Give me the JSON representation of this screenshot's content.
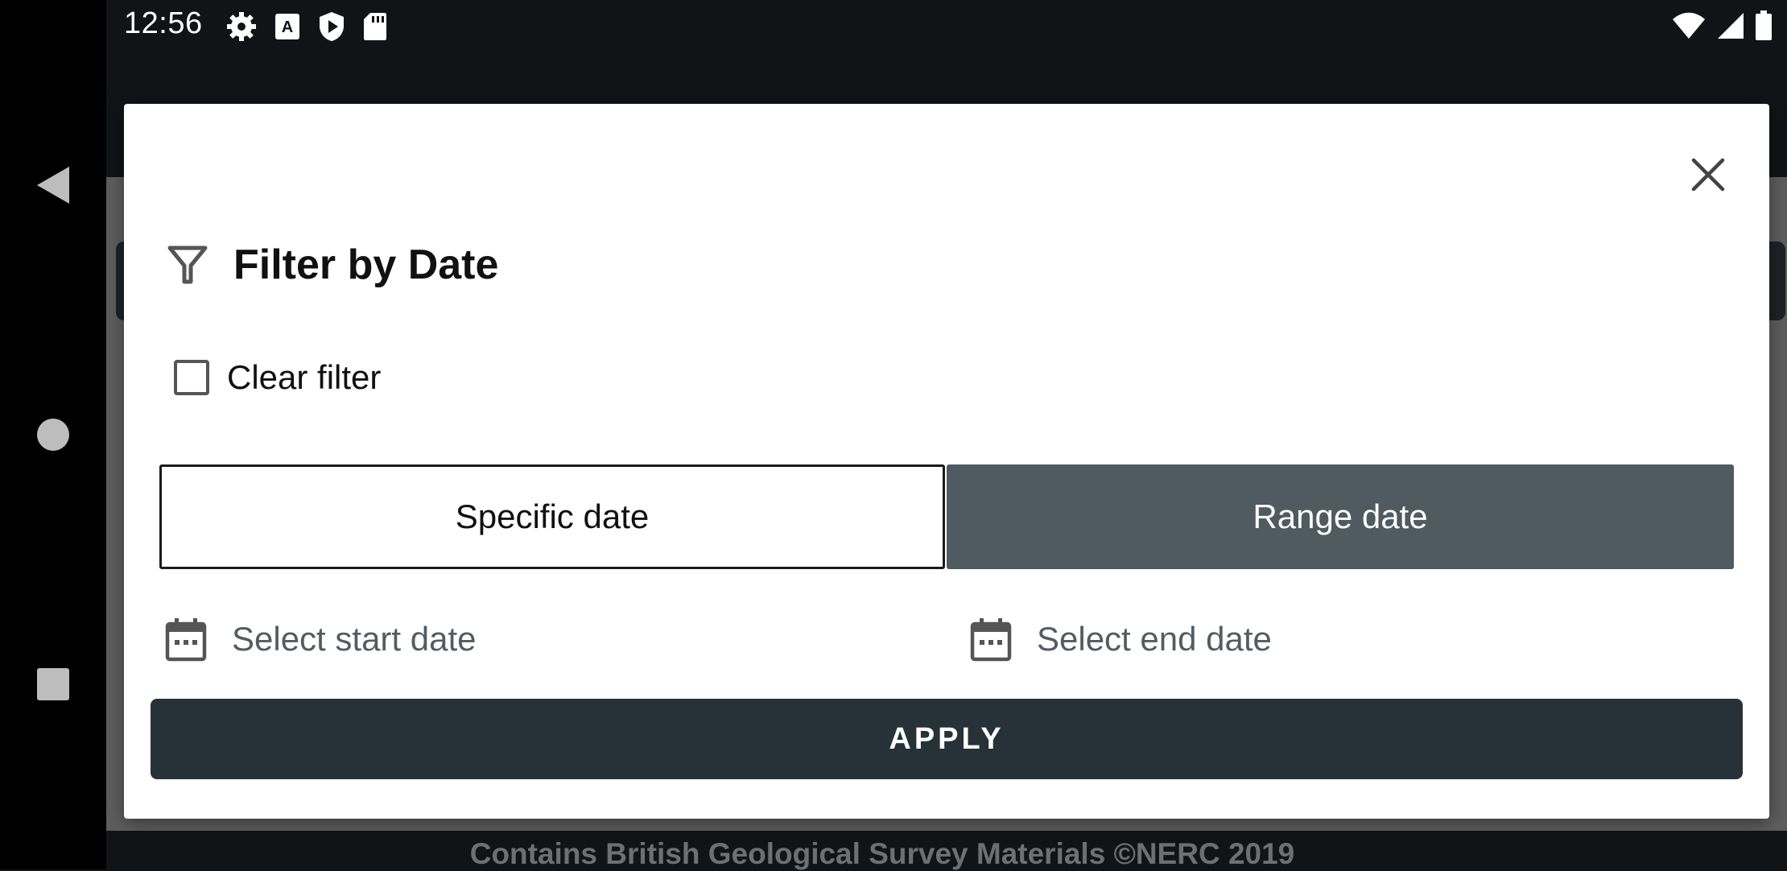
{
  "status_bar": {
    "time": "12:56",
    "left_icons": [
      "settings-icon",
      "font-icon",
      "shield-play-icon",
      "sd-card-icon"
    ],
    "right_icons": [
      "wifi-icon",
      "signal-icon",
      "battery-icon"
    ]
  },
  "nav_bar": {
    "buttons": [
      "back",
      "home",
      "recents"
    ]
  },
  "background_app": {
    "attribution": "Contains British Geological Survey Materials ©NERC 2019"
  },
  "dialog": {
    "title": "Filter by Date",
    "clear_filter_label": "Clear filter",
    "clear_filter_checked": false,
    "mode_options": [
      "Specific date",
      "Range date"
    ],
    "selected_mode": "Range date",
    "start_date_placeholder": "Select start date",
    "end_date_placeholder": "Select end date",
    "apply_label": "APPLY"
  },
  "colors": {
    "dialog_background": "#ffffff",
    "selected_segment": "#4f5a61",
    "apply_button": "#263238",
    "status_bar": "#111417"
  }
}
